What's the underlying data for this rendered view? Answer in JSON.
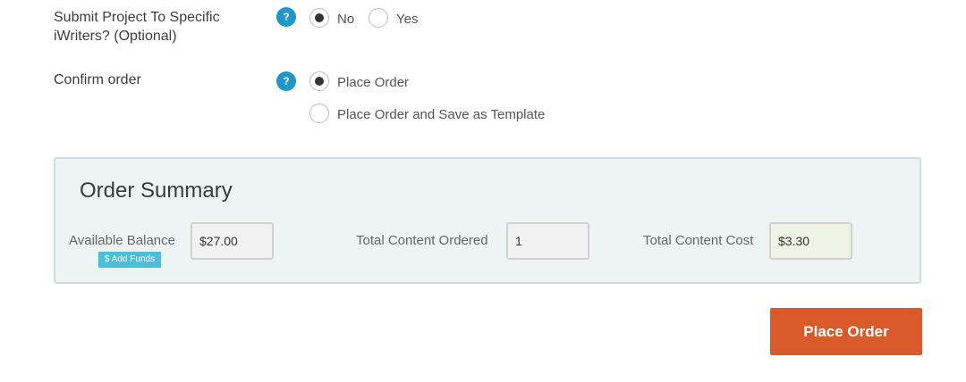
{
  "submit_writers": {
    "label": "Submit Project To Specific iWriters? (Optional)",
    "help_icon": "?",
    "options": [
      {
        "label": "No",
        "checked": true
      },
      {
        "label": "Yes",
        "checked": false
      }
    ]
  },
  "confirm_order": {
    "label": "Confirm order",
    "help_icon": "?",
    "options": [
      {
        "label": "Place Order",
        "checked": true
      },
      {
        "label": "Place Order and Save as Template",
        "checked": false
      }
    ]
  },
  "order_summary": {
    "title": "Order Summary",
    "available_balance": {
      "label": "Available Balance",
      "value": "$27.00"
    },
    "add_funds": "$ Add Funds",
    "total_content_ordered": {
      "label": "Total Content Ordered",
      "value": "1"
    },
    "total_content_cost": {
      "label": "Total Content Cost",
      "value": "$3.30"
    }
  },
  "place_order_button": "Place Order",
  "colors": {
    "help_icon": "#2196c9",
    "primary_button": "#db5a2a",
    "add_funds": "#48c0dc",
    "summary_background": "#eef4f4"
  }
}
